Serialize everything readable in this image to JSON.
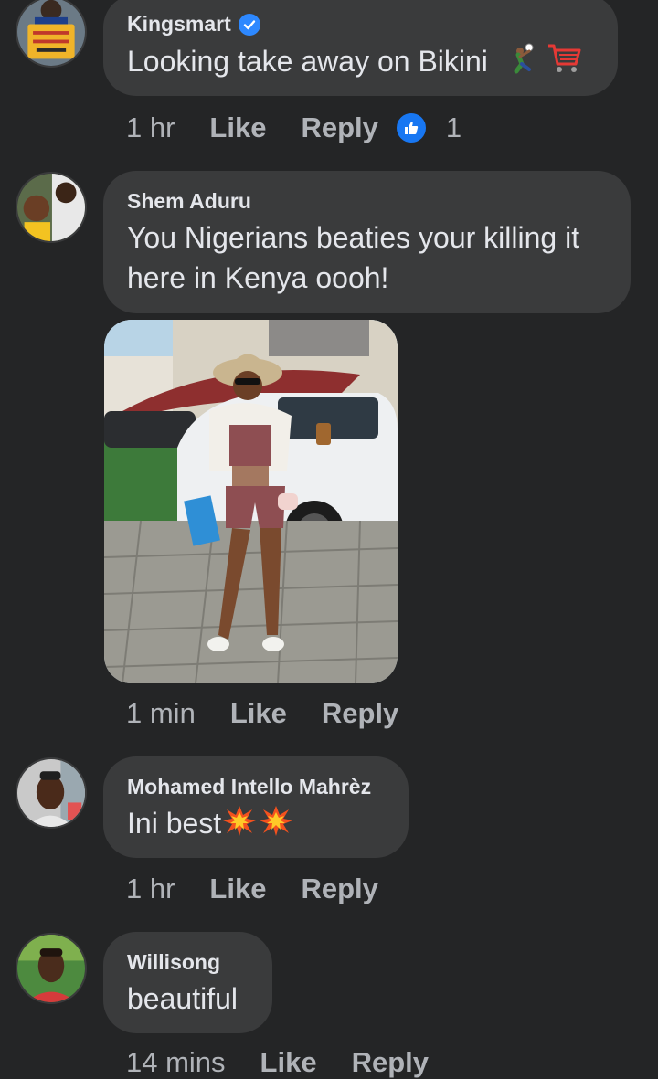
{
  "comments": [
    {
      "author": "Kingsmart",
      "verified": true,
      "text": "Looking take away on Bikini",
      "emojis": [
        "person-volleyball-icon",
        "shopping-cart-icon"
      ],
      "time": "1 hr",
      "like_label": "Like",
      "reply_label": "Reply",
      "reaction_count": "1"
    },
    {
      "author": "Shem Aduru",
      "text_line1": "You Nigerians beaties your killing it",
      "text_line2": "here in Kenya oooh!",
      "attachment": "photo",
      "time": "1 min",
      "like_label": "Like",
      "reply_label": "Reply"
    },
    {
      "author": "Mohamed Intello Mahrèz",
      "text": "Ini best",
      "emojis": [
        "collision-icon",
        "collision-icon"
      ],
      "time": "1 hr",
      "like_label": "Like",
      "reply_label": "Reply"
    },
    {
      "author": "Willisong",
      "text": "beautiful",
      "time": "14 mins",
      "like_label": "Like",
      "reply_label": "Reply"
    }
  ],
  "colors": {
    "background": "#242526",
    "bubble": "#3a3b3c",
    "text": "#e4e6eb",
    "secondary_text": "#b0b3b8",
    "accent": "#1877f2"
  }
}
